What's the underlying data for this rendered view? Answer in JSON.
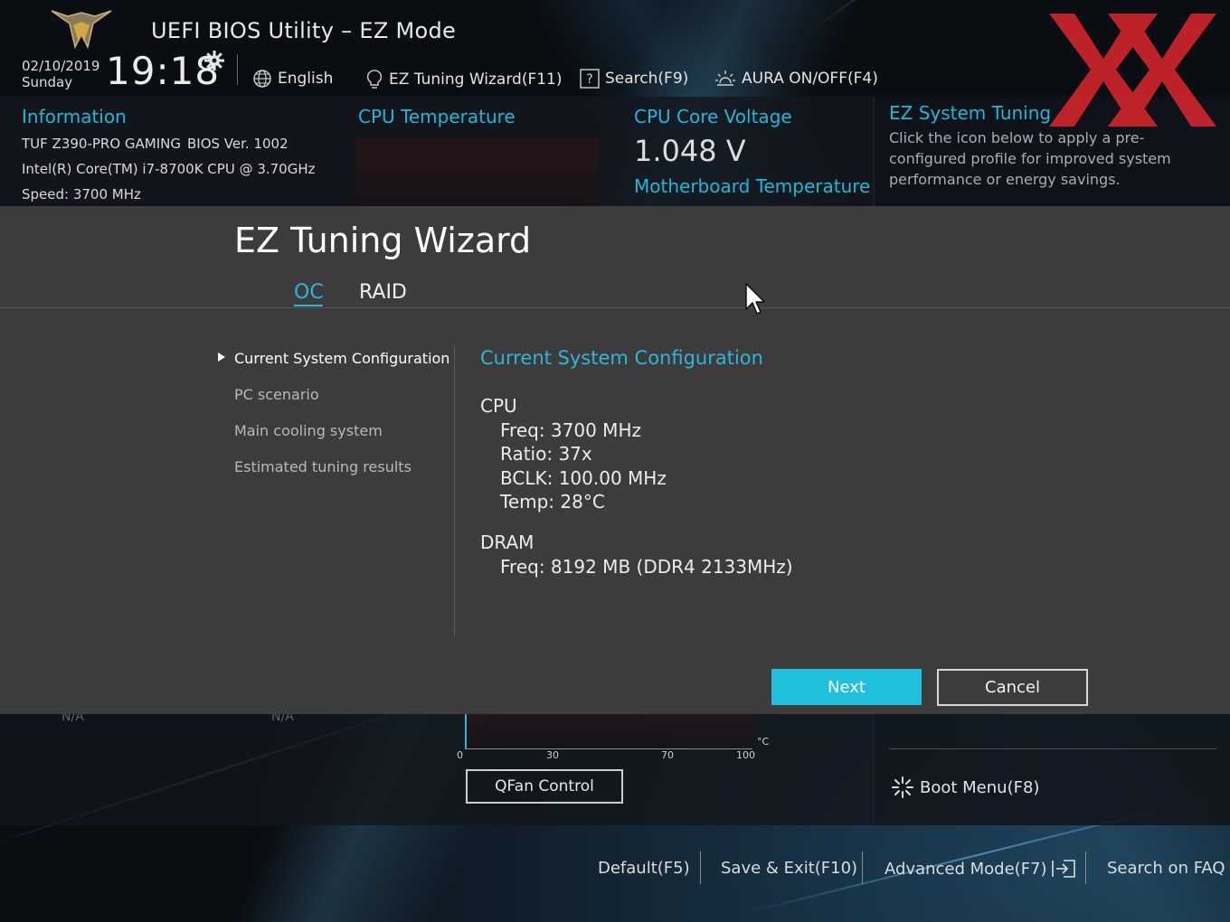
{
  "header": {
    "title": "UEFI BIOS Utility – EZ Mode",
    "date": "02/10/2019",
    "day": "Sunday",
    "time": "19:18",
    "language": "English",
    "tuning_wizard": "EZ Tuning Wizard(F11)",
    "search": "Search(F9)",
    "aura": "AURA ON/OFF(F4)"
  },
  "info": {
    "heading": "Information",
    "board": "TUF Z390-PRO GAMING",
    "bios": "BIOS Ver. 1002",
    "cpu": "Intel(R) Core(TM) i7-8700K CPU @ 3.70GHz",
    "speed": "Speed: 3700 MHz",
    "cpu_temp_label": "CPU Temperature",
    "cpu_volt_label": "CPU Core Voltage",
    "cpu_volt_value": "1.048 V",
    "mb_temp_label": "Motherboard Temperature"
  },
  "ez_system": {
    "title": "EZ System Tuning",
    "description": "Click the icon below to apply a pre-configured profile for improved system performance or energy savings."
  },
  "wizard": {
    "title": "EZ Tuning Wizard",
    "tabs": [
      {
        "label": "OC",
        "active": true
      },
      {
        "label": "RAID",
        "active": false
      }
    ],
    "steps": [
      {
        "label": "Current System Configuration",
        "active": true
      },
      {
        "label": "PC scenario",
        "active": false
      },
      {
        "label": "Main cooling system",
        "active": false
      },
      {
        "label": "Estimated tuning results",
        "active": false
      }
    ],
    "config": {
      "title": "Current System Configuration",
      "cpu_heading": "CPU",
      "cpu_lines": [
        "Freq: 3700 MHz",
        "Ratio: 37x",
        "BCLK: 100.00 MHz",
        "Temp: 28°C"
      ],
      "dram_heading": "DRAM",
      "dram_lines": [
        "Freq: 8192 MB (DDR4 2133MHz)"
      ]
    },
    "next_label": "Next",
    "cancel_label": "Cancel"
  },
  "lower": {
    "na1": "N/A",
    "na2": "N/A",
    "fan_ticks": [
      "0",
      "30",
      "70",
      "100"
    ],
    "fan_unit": "°C",
    "qfan_label": "QFan Control",
    "boot_menu": "Boot Menu(F8)"
  },
  "footer": {
    "default": "Default(F5)",
    "save_exit": "Save & Exit(F10)",
    "advanced": "Advanced Mode(F7)",
    "faq": "Search on FAQ"
  },
  "colors": {
    "accent": "#1fb8d6",
    "next_button": "#21c0da",
    "modal_bg": "#3c3c3c",
    "watermark": "#c8242b"
  },
  "icons": [
    "tuf-logo-icon",
    "gear-icon",
    "globe-icon",
    "lightbulb-icon",
    "search-icon",
    "aura-icon",
    "boot-icon",
    "exit-icon",
    "mouse-cursor-icon"
  ]
}
